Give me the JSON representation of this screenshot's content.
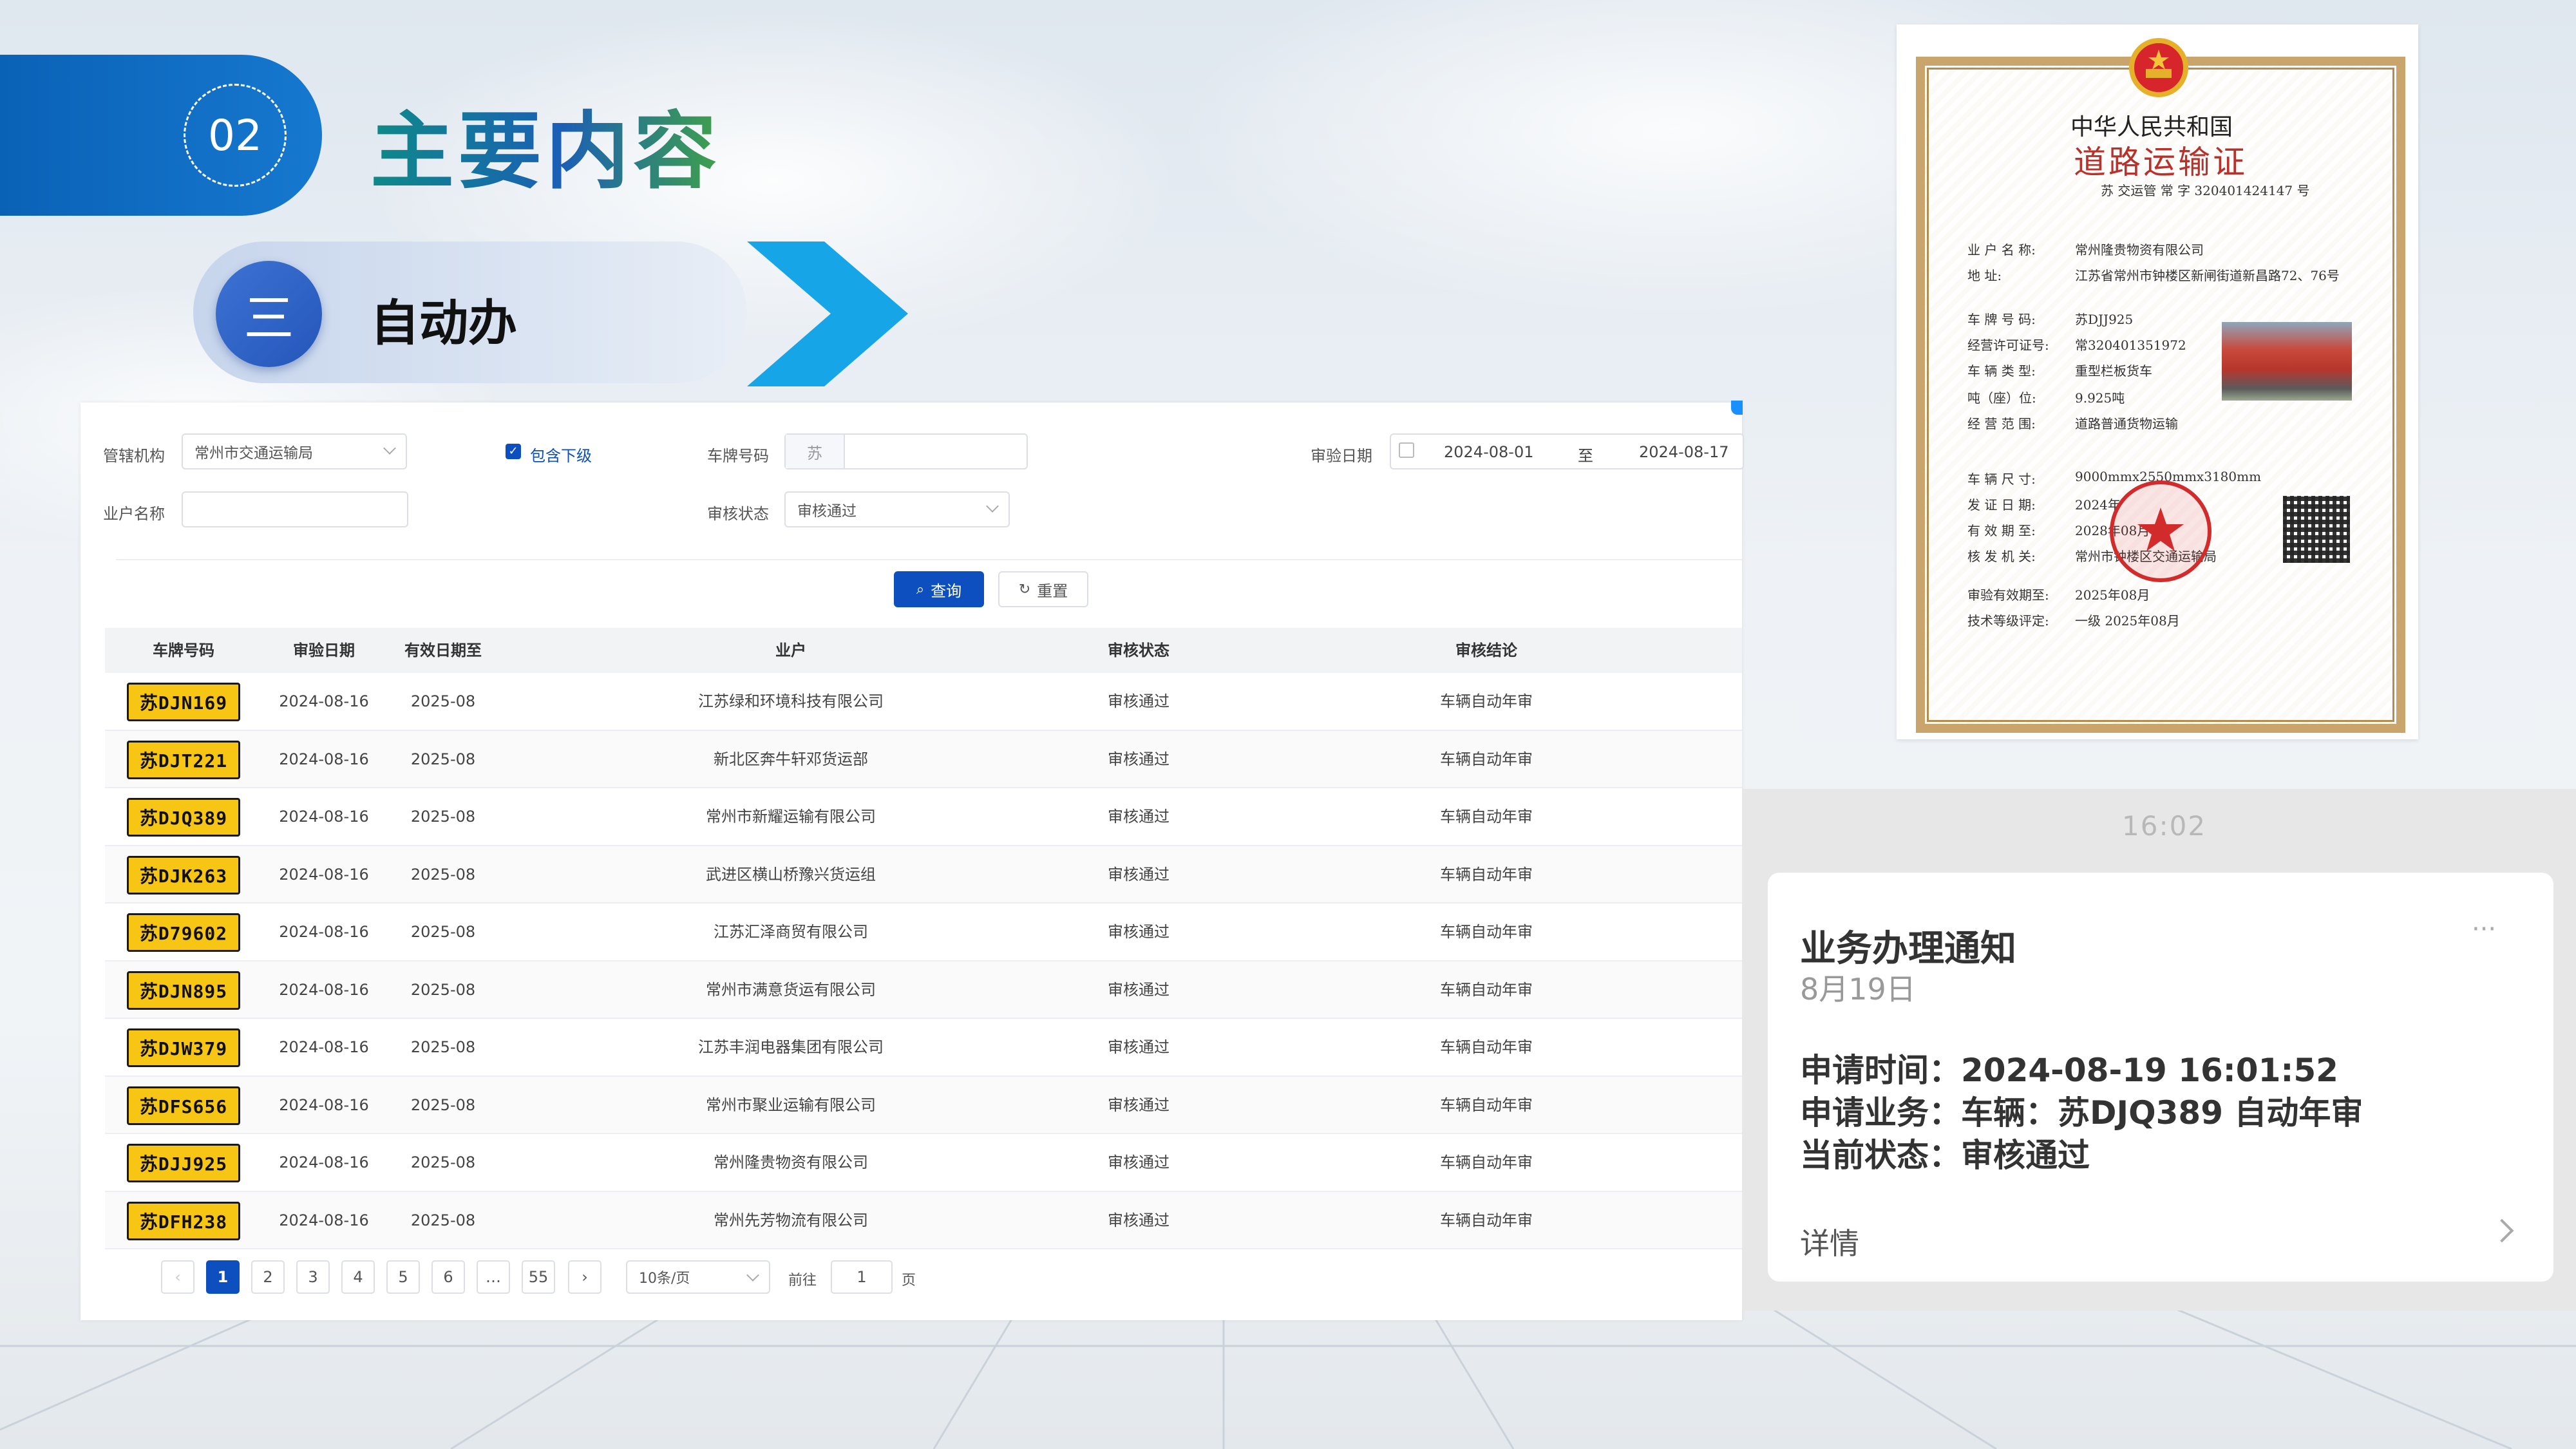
{
  "header": {
    "section_number": "02",
    "title": "主要内容",
    "sub_number": "三",
    "sub_title": "自动办"
  },
  "colors": {
    "primary": "#0d4fbe",
    "badge_blue": "#0a62b6",
    "plate_yellow": "#f7c513",
    "chevron": "#16a6e8",
    "cert_border": "#c9a56b",
    "stamp_red": "#d22b2b"
  },
  "filters": {
    "org_label": "管辖机构",
    "org_value": "常州市交通运输局",
    "include_sub_label": "包含下级",
    "include_sub_checked": true,
    "plate_label": "车牌号码",
    "plate_prefix": "苏",
    "plate_value": "",
    "date_label": "审验日期",
    "date_from": "2024-08-01",
    "date_sep": "至",
    "date_to": "2024-08-17",
    "owner_label": "业户名称",
    "owner_value": "",
    "status_label": "审核状态",
    "status_value": "审核通过"
  },
  "buttons": {
    "query": "查询",
    "reset": "重置"
  },
  "table": {
    "columns": [
      "车牌号码",
      "审验日期",
      "有效日期至",
      "业户",
      "审核状态",
      "审核结论"
    ],
    "rows": [
      {
        "plate": "苏DJN169",
        "date": "2024-08-16",
        "valid": "2025-08",
        "owner": "江苏绿和环境科技有限公司",
        "status": "审核通过",
        "result": "车辆自动年审"
      },
      {
        "plate": "苏DJT221",
        "date": "2024-08-16",
        "valid": "2025-08",
        "owner": "新北区奔牛轩邓货运部",
        "status": "审核通过",
        "result": "车辆自动年审"
      },
      {
        "plate": "苏DJQ389",
        "date": "2024-08-16",
        "valid": "2025-08",
        "owner": "常州市新耀运输有限公司",
        "status": "审核通过",
        "result": "车辆自动年审"
      },
      {
        "plate": "苏DJK263",
        "date": "2024-08-16",
        "valid": "2025-08",
        "owner": "武进区横山桥豫兴货运组",
        "status": "审核通过",
        "result": "车辆自动年审"
      },
      {
        "plate": "苏D79602",
        "date": "2024-08-16",
        "valid": "2025-08",
        "owner": "江苏汇泽商贸有限公司",
        "status": "审核通过",
        "result": "车辆自动年审"
      },
      {
        "plate": "苏DJN895",
        "date": "2024-08-16",
        "valid": "2025-08",
        "owner": "常州市满意货运有限公司",
        "status": "审核通过",
        "result": "车辆自动年审"
      },
      {
        "plate": "苏DJW379",
        "date": "2024-08-16",
        "valid": "2025-08",
        "owner": "江苏丰润电器集团有限公司",
        "status": "审核通过",
        "result": "车辆自动年审"
      },
      {
        "plate": "苏DFS656",
        "date": "2024-08-16",
        "valid": "2025-08",
        "owner": "常州市聚业运输有限公司",
        "status": "审核通过",
        "result": "车辆自动年审"
      },
      {
        "plate": "苏DJJ925",
        "date": "2024-08-16",
        "valid": "2025-08",
        "owner": "常州隆贵物资有限公司",
        "status": "审核通过",
        "result": "车辆自动年审"
      },
      {
        "plate": "苏DFH238",
        "date": "2024-08-16",
        "valid": "2025-08",
        "owner": "常州先芳物流有限公司",
        "status": "审核通过",
        "result": "车辆自动年审"
      }
    ]
  },
  "pagination": {
    "prev": "‹",
    "next": "›",
    "pages": [
      "1",
      "2",
      "3",
      "4",
      "5",
      "6",
      "…",
      "55"
    ],
    "current": 1,
    "page_size": "10条/页",
    "goto_label": "前往",
    "goto_value": "1",
    "page_unit": "页"
  },
  "certificate": {
    "title1": "中华人民共和国",
    "title2": "道路运输证",
    "number_line": "苏  交运管 常 字 320401424147  号",
    "fields": [
      {
        "label": "业 户 名 称:",
        "value": "常州隆贵物资有限公司"
      },
      {
        "label": "地         址:",
        "value": "江苏省常州市钟楼区新闸街道新昌路72、76号"
      },
      {
        "label": "车 牌 号 码:",
        "value": "苏DJJ925"
      },
      {
        "label": "经营许可证号:",
        "value": "常320401351972"
      },
      {
        "label": "车 辆 类 型:",
        "value": "重型栏板货车"
      },
      {
        "label": "吨（座）位:",
        "value": "9.925吨"
      },
      {
        "label": "经 营 范 围:",
        "value": "道路普通货物运输"
      },
      {
        "label": "车 辆 尺 寸:",
        "value": "9000mmx2550mmx3180mm"
      },
      {
        "label": "发 证 日 期:",
        "value": "2024年"
      },
      {
        "label": "有 效 期 至:",
        "value": "2028年08月"
      },
      {
        "label": "核 发 机 关:",
        "value": "常州市钟楼区交通运输局"
      },
      {
        "label": "审验有效期至:",
        "value": "2025年08月"
      },
      {
        "label": "技术等级评定:",
        "value": "一级        2025年08月"
      }
    ]
  },
  "notification": {
    "time": "16:02",
    "title": "业务办理通知",
    "date": "8月19日",
    "apply_time": "申请时间：2024-08-19 16:01:52",
    "apply_business": "申请业务：车辆：苏DJQ389 自动年审",
    "current_status": "当前状态：审核通过",
    "details": "详情",
    "more": "···"
  }
}
